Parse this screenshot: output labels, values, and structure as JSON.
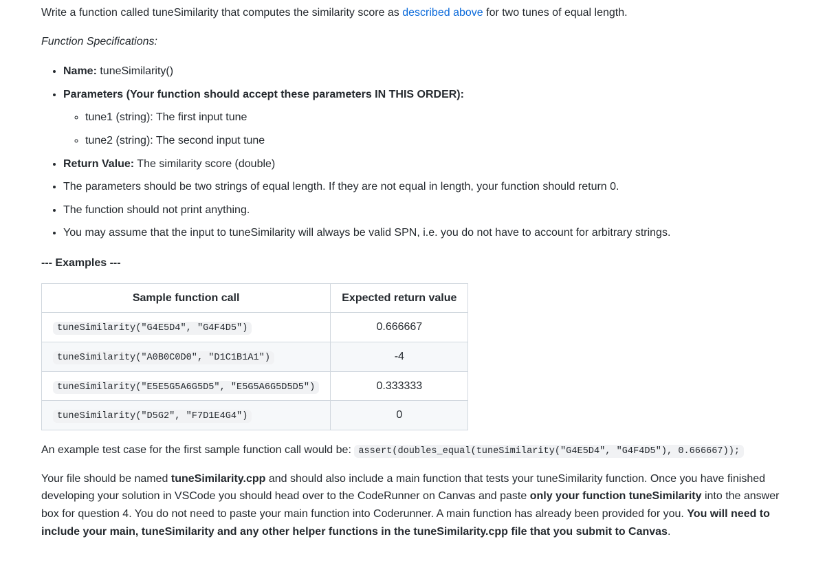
{
  "intro": {
    "before_link": "Write a function called tuneSimilarity that computes the similarity score as ",
    "link": "described above",
    "after_link": " for two tunes of equal length."
  },
  "spec_heading": "Function Specifications:",
  "specs": {
    "name_label": "Name:",
    "name_value": " tuneSimilarity()",
    "params_label": "Parameters (Your function should accept these parameters IN THIS ORDER):",
    "param1": "tune1 (string): The first input tune",
    "param2": "tune2 (string): The second input tune",
    "return_label": "Return Value:",
    "return_value": " The similarity score (double)",
    "rule_equal_length": "The parameters should be two strings of equal length. If they are not equal in length, your function should return 0.",
    "rule_no_print": "The function should not print anything.",
    "rule_valid_spn": "You may assume that the input to tuneSimilarity will always be valid SPN, i.e. you do not have to account for arbitrary strings."
  },
  "examples_header": "--- Examples ---",
  "table": {
    "col1": "Sample function call",
    "col2": "Expected return value",
    "rows": [
      {
        "call": "tuneSimilarity(\"G4E5D4\", \"G4F4D5\")",
        "ret": "0.666667"
      },
      {
        "call": "tuneSimilarity(\"A0B0C0D0\", \"D1C1B1A1\")",
        "ret": "-4"
      },
      {
        "call": "tuneSimilarity(\"E5E5G5A6G5D5\", \"E5G5A6G5D5D5\")",
        "ret": "0.333333"
      },
      {
        "call": "tuneSimilarity(\"D5G2\", \"F7D1E4G4\")",
        "ret": "0"
      }
    ]
  },
  "assert": {
    "before": "An example test case for the first sample function call would be: ",
    "code": "assert(doubles_equal(tuneSimilarity(\"G4E5D4\", \"G4F4D5\"), 0.666667));"
  },
  "closing": {
    "p1a": "Your file should be named ",
    "p1b": "tuneSimilarity.cpp",
    "p1c": " and should also include a main function that tests your tuneSimilarity function. Once you have finished developing your solution in VSCode you should head over to the CodeRunner on Canvas and paste ",
    "p1d": "only your function tuneSimilarity",
    "p1e": " into the answer box for question 4. You do not need to paste your main function into Coderunner. A main function has already been provided for you. ",
    "p1f": "You will need to include your main, tuneSimilarity and any other helper functions in the tuneSimilarity.cpp file that you submit to Canvas",
    "p1g": "."
  }
}
